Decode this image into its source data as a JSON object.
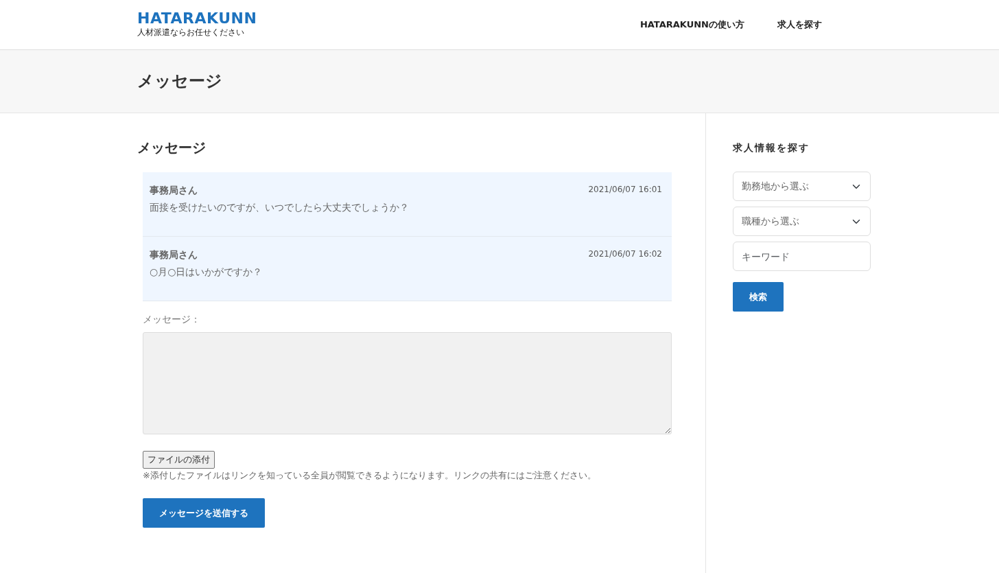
{
  "header": {
    "logo": "HATARAKUNN",
    "tagline": "人材派遣ならお任せください",
    "nav": [
      "HATARAKUNNの使い方",
      "求人を探す"
    ]
  },
  "page_title": "メッセージ",
  "main": {
    "heading": "メッセージ",
    "messages": [
      {
        "sender": "事務局さん",
        "time": "2021/06/07 16:01",
        "body": "面接を受けたいのですが、いつでしたら大丈夫でしょうか？"
      },
      {
        "sender": "事務局さん",
        "time": "2021/06/07 16:02",
        "body": "○月○日はいかがですか？"
      }
    ],
    "form": {
      "label": "メッセージ：",
      "attach_button": "ファイルの添付",
      "note": "※添付したファイルはリンクを知っている全員が閲覧できるようになります。リンクの共有にはご注意ください。",
      "submit": "メッセージを送信する"
    }
  },
  "sidebar": {
    "heading": "求人情報を探す",
    "selects": [
      "勤務地から選ぶ",
      "職種から選ぶ"
    ],
    "keyword": {
      "placeholder": "キーワード"
    },
    "search_button": "検索"
  }
}
